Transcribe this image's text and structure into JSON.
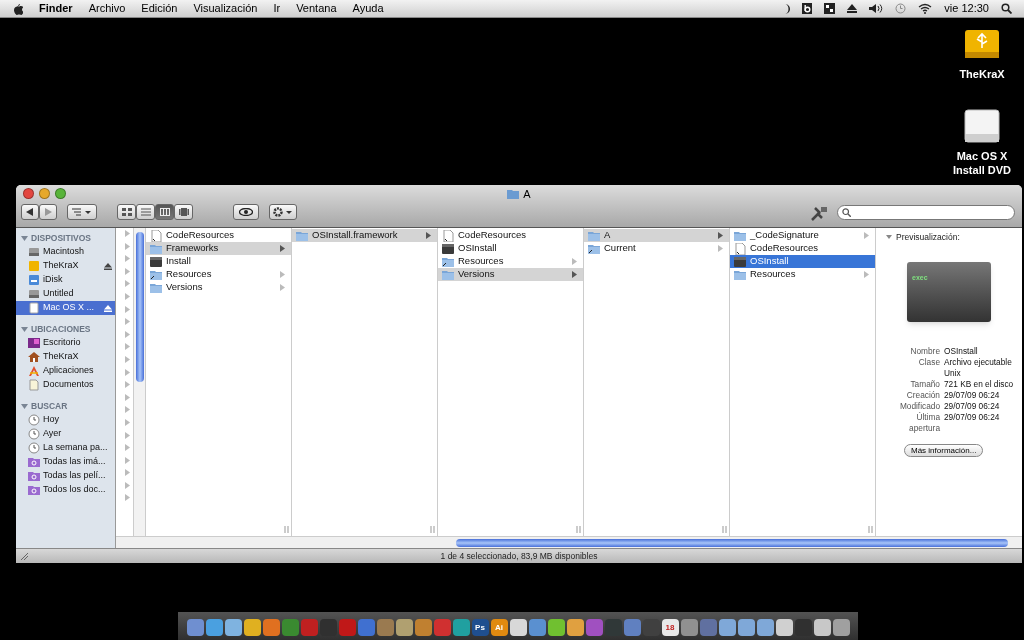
{
  "menubar": {
    "app": "Finder",
    "items": [
      "Archivo",
      "Edición",
      "Visualización",
      "Ir",
      "Ventana",
      "Ayuda"
    ],
    "clock": "vie 12:30"
  },
  "desktop_icons": [
    {
      "label": "TheKraX",
      "kind": "usb"
    },
    {
      "label": "Mac OS X Install DVD",
      "kind": "dvd"
    }
  ],
  "window": {
    "title": "A",
    "sidebar": [
      {
        "heading": "DISPOSITIVOS",
        "expanded": true,
        "items": [
          {
            "label": "Macintosh",
            "kind": "disk",
            "selected": false,
            "eject": false
          },
          {
            "label": "TheKraX",
            "kind": "usb",
            "selected": false,
            "eject": true
          },
          {
            "label": "iDisk",
            "kind": "idisk",
            "selected": false,
            "eject": false
          },
          {
            "label": "Untitled",
            "kind": "disk",
            "selected": false,
            "eject": false
          },
          {
            "label": "Mac OS X ...",
            "kind": "dvd",
            "selected": true,
            "eject": true
          }
        ]
      },
      {
        "heading": "UBICACIONES",
        "expanded": true,
        "items": [
          {
            "label": "Escritorio",
            "kind": "desktop",
            "selected": false,
            "eject": false
          },
          {
            "label": "TheKraX",
            "kind": "home",
            "selected": false,
            "eject": false
          },
          {
            "label": "Aplicaciones",
            "kind": "apps",
            "selected": false,
            "eject": false
          },
          {
            "label": "Documentos",
            "kind": "docs",
            "selected": false,
            "eject": false
          }
        ]
      },
      {
        "heading": "BUSCAR",
        "expanded": true,
        "items": [
          {
            "label": "Hoy",
            "kind": "clock",
            "selected": false,
            "eject": false
          },
          {
            "label": "Ayer",
            "kind": "clock",
            "selected": false,
            "eject": false
          },
          {
            "label": "La semana pa...",
            "kind": "clock",
            "selected": false,
            "eject": false
          },
          {
            "label": "Todas las imá...",
            "kind": "smart",
            "selected": false,
            "eject": false
          },
          {
            "label": "Todas las pelí...",
            "kind": "smart",
            "selected": false,
            "eject": false
          },
          {
            "label": "Todos los doc...",
            "kind": "smart",
            "selected": false,
            "eject": false
          }
        ]
      }
    ],
    "columns": [
      {
        "active": false,
        "items": [
          {
            "label": "CodeResources",
            "kind": "file",
            "selected": false,
            "has_children": false
          },
          {
            "label": "Frameworks",
            "kind": "folder",
            "selected": true,
            "has_children": true
          },
          {
            "label": "Install",
            "kind": "exec",
            "selected": false,
            "has_children": false
          },
          {
            "label": "Resources",
            "kind": "alias",
            "selected": false,
            "has_children": true
          },
          {
            "label": "Versions",
            "kind": "folder",
            "selected": false,
            "has_children": true
          }
        ]
      },
      {
        "active": false,
        "items": [
          {
            "label": "OSInstall.framework",
            "kind": "folder",
            "selected": true,
            "has_children": true
          }
        ]
      },
      {
        "active": false,
        "items": [
          {
            "label": "CodeResources",
            "kind": "file",
            "selected": false,
            "has_children": false
          },
          {
            "label": "OSInstall",
            "kind": "exec",
            "selected": false,
            "has_children": false
          },
          {
            "label": "Resources",
            "kind": "alias",
            "selected": false,
            "has_children": true
          },
          {
            "label": "Versions",
            "kind": "folder",
            "selected": true,
            "has_children": true
          }
        ]
      },
      {
        "active": false,
        "items": [
          {
            "label": "A",
            "kind": "folder",
            "selected": true,
            "has_children": true
          },
          {
            "label": "Current",
            "kind": "alias",
            "selected": false,
            "has_children": true
          }
        ]
      },
      {
        "active": true,
        "items": [
          {
            "label": "_CodeSignature",
            "kind": "folder",
            "selected": false,
            "has_children": true
          },
          {
            "label": "CodeResources",
            "kind": "file",
            "selected": false,
            "has_children": false
          },
          {
            "label": "OSInstall",
            "kind": "exec",
            "selected": true,
            "has_children": false
          },
          {
            "label": "Resources",
            "kind": "folder",
            "selected": false,
            "has_children": true
          }
        ]
      }
    ],
    "preview": {
      "heading": "Previsualización:",
      "icon_label": "exec",
      "info": [
        {
          "label": "Nombre",
          "value": "OSInstall"
        },
        {
          "label": "Clase",
          "value": "Archivo ejecutable Unix"
        },
        {
          "label": "Tamaño",
          "value": "721 KB en el disco"
        },
        {
          "label": "Creación",
          "value": "29/07/09 06:24"
        },
        {
          "label": "Modificado",
          "value": "29/07/09 06:24"
        },
        {
          "label": "Última apertura",
          "value": "29/07/09 06:24"
        }
      ],
      "button": "Más información..."
    },
    "status": "1 de 4 seleccionado, 83,9 MB disponibles"
  },
  "dock": [
    {
      "color": "#6f8fd0"
    },
    {
      "color": "#4aa0e0"
    },
    {
      "color": "#7fb3e0"
    },
    {
      "color": "#e0b020"
    },
    {
      "color": "#e07020"
    },
    {
      "color": "#3a8a30"
    },
    {
      "color": "#c02020"
    },
    {
      "color": "#303030"
    },
    {
      "color": "#c01818"
    },
    {
      "color": "#4070d0"
    },
    {
      "color": "#9a7a50"
    },
    {
      "color": "#b0a070"
    },
    {
      "color": "#c08030"
    },
    {
      "color": "#d03030"
    },
    {
      "color": "#20a0a0"
    },
    {
      "color": "#1f4f8f",
      "glyph": "Ps"
    },
    {
      "color": "#e08a10",
      "glyph": "Ai"
    },
    {
      "color": "#d8d8d8"
    },
    {
      "color": "#5a90d0"
    },
    {
      "color": "#70c030"
    },
    {
      "color": "#e0a040"
    },
    {
      "color": "#a050c0"
    },
    {
      "color": "#303838"
    },
    {
      "color": "#6080c0"
    },
    {
      "color": "#404040"
    },
    {
      "color": "#e8e8e8",
      "glyph": "18"
    },
    {
      "color": "#909090"
    },
    {
      "color": "#6070a0"
    },
    {
      "color": "#7fa8d8"
    },
    {
      "color": "#7fa8d8"
    },
    {
      "color": "#7fa8d8"
    },
    {
      "color": "#d0d0d0"
    },
    {
      "color": "#303030"
    },
    {
      "color": "#c8c8c8"
    },
    {
      "color": "#a0a0a0"
    }
  ]
}
